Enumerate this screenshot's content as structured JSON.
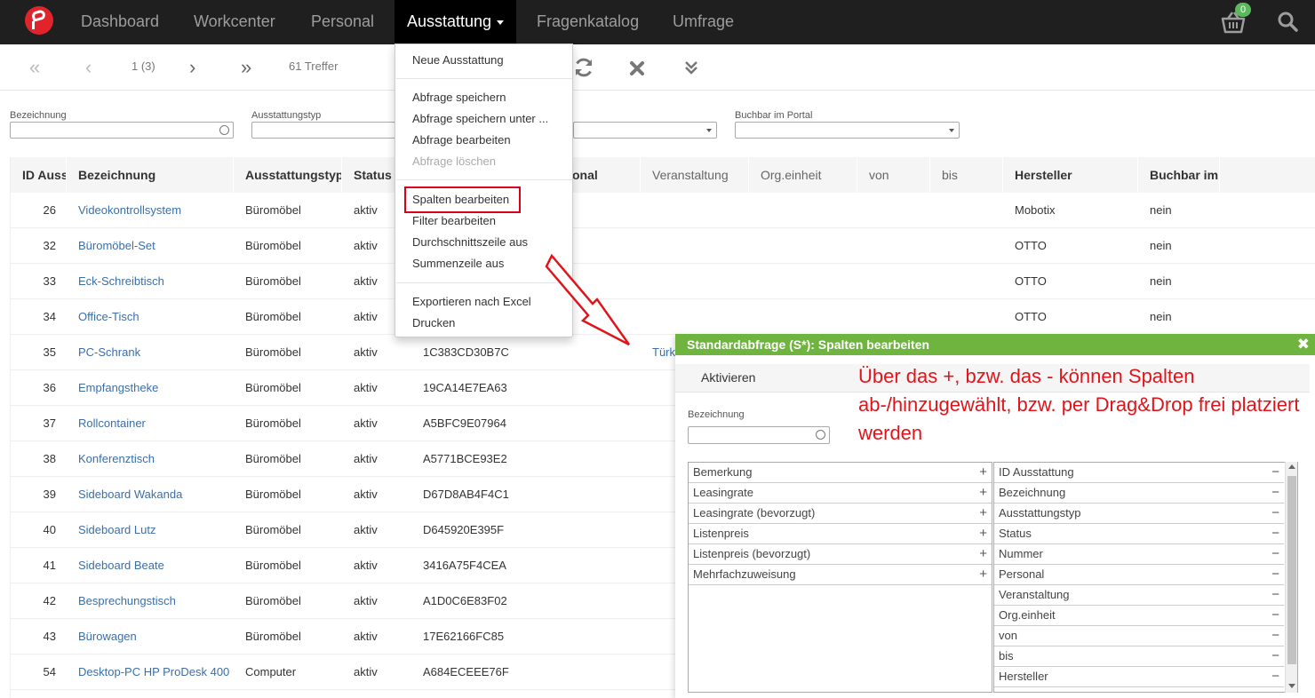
{
  "nav": {
    "items": [
      {
        "label": "Dashboard"
      },
      {
        "label": "Workcenter"
      },
      {
        "label": "Personal"
      },
      {
        "label": "Ausstattung"
      },
      {
        "label": "Fragenkatalog"
      },
      {
        "label": "Umfrage"
      }
    ],
    "active_index": 3,
    "cart_count": "0"
  },
  "toolbar": {
    "page": "1 (3)",
    "hits": "61 Treffer"
  },
  "filters": [
    {
      "label": "Bezeichnung",
      "value": ""
    },
    {
      "label": "Ausstattungstyp",
      "value": ""
    },
    {
      "label": "Buchbar im Portal",
      "value": ""
    }
  ],
  "grid": {
    "columns": [
      "ID Ausst",
      "Bezeichnung",
      "Ausstattungstyp",
      "Status",
      "",
      "onal",
      "Veranstaltung",
      "Org.einheit",
      "von",
      "bis",
      "Hersteller",
      "Buchbar im I"
    ],
    "rows": [
      {
        "id": "26",
        "name": "Videokontrollsystem",
        "type": "Büromöbel",
        "status": "aktiv",
        "number": "",
        "veranstaltung": "",
        "maker": "Mobotix",
        "book": "nein"
      },
      {
        "id": "32",
        "name": "Büromöbel-Set",
        "type": "Büromöbel",
        "status": "aktiv",
        "number": "",
        "veranstaltung": "",
        "maker": "OTTO",
        "book": "nein"
      },
      {
        "id": "33",
        "name": "Eck-Schreibtisch",
        "type": "Büromöbel",
        "status": "aktiv",
        "number": "",
        "veranstaltung": "",
        "maker": "OTTO",
        "book": "nein"
      },
      {
        "id": "34",
        "name": "Office-Tisch",
        "type": "Büromöbel",
        "status": "aktiv",
        "number": "",
        "veranstaltung": "",
        "maker": "OTTO",
        "book": "nein"
      },
      {
        "id": "35",
        "name": "PC-Schrank",
        "type": "Büromöbel",
        "status": "aktiv",
        "number": "1C383CD30B7C",
        "veranstaltung": "Türk",
        "maker": "",
        "book": ""
      },
      {
        "id": "36",
        "name": "Empfangstheke",
        "type": "Büromöbel",
        "status": "aktiv",
        "number": "19CA14E7EA63",
        "veranstaltung": "",
        "maker": "",
        "book": ""
      },
      {
        "id": "37",
        "name": "Rollcontainer",
        "type": "Büromöbel",
        "status": "aktiv",
        "number": "A5BFC9E07964",
        "veranstaltung": "",
        "maker": "",
        "book": ""
      },
      {
        "id": "38",
        "name": "Konferenztisch",
        "type": "Büromöbel",
        "status": "aktiv",
        "number": "A5771BCE93E2",
        "veranstaltung": "",
        "maker": "",
        "book": ""
      },
      {
        "id": "39",
        "name": "Sideboard Wakanda",
        "type": "Büromöbel",
        "status": "aktiv",
        "number": "D67D8AB4F4C1",
        "veranstaltung": "",
        "maker": "",
        "book": ""
      },
      {
        "id": "40",
        "name": "Sideboard Lutz",
        "type": "Büromöbel",
        "status": "aktiv",
        "number": "D645920E395F",
        "veranstaltung": "",
        "maker": "",
        "book": ""
      },
      {
        "id": "41",
        "name": "Sideboard Beate",
        "type": "Büromöbel",
        "status": "aktiv",
        "number": "3416A75F4CEA",
        "veranstaltung": "",
        "maker": "",
        "book": ""
      },
      {
        "id": "42",
        "name": "Besprechungstisch",
        "type": "Büromöbel",
        "status": "aktiv",
        "number": "A1D0C6E83F02",
        "veranstaltung": "",
        "maker": "",
        "book": ""
      },
      {
        "id": "43",
        "name": "Bürowagen",
        "type": "Büromöbel",
        "status": "aktiv",
        "number": "17E62166FC85",
        "veranstaltung": "",
        "maker": "",
        "book": ""
      },
      {
        "id": "54",
        "name": "Desktop-PC HP ProDesk 400",
        "type": "Computer",
        "status": "aktiv",
        "number": "A684ECEEE76F",
        "veranstaltung": "",
        "maker": "",
        "book": ""
      }
    ]
  },
  "menu": {
    "groups": [
      [
        {
          "label": "Neue Ausstattung",
          "disabled": false
        }
      ],
      [
        {
          "label": "Abfrage speichern",
          "disabled": false
        },
        {
          "label": "Abfrage speichern unter ...",
          "disabled": false
        },
        {
          "label": "Abfrage bearbeiten",
          "disabled": false
        },
        {
          "label": "Abfrage löschen",
          "disabled": true
        }
      ],
      [
        {
          "label": "Spalten bearbeiten",
          "disabled": false
        },
        {
          "label": "Filter bearbeiten",
          "disabled": false
        },
        {
          "label": "Durchschnittszeile aus",
          "disabled": false
        },
        {
          "label": "Summenzeile aus",
          "disabled": false
        }
      ],
      [
        {
          "label": "Exportieren nach Excel",
          "disabled": false
        },
        {
          "label": "Drucken",
          "disabled": false
        }
      ]
    ]
  },
  "dialog": {
    "title": "Standardabfrage (S*): Spalten bearbeiten",
    "activate": "Aktivieren",
    "note": "Über das +, bzw. das - können Spalten ab-/hinzugewählt, bzw. per Drag&Drop frei platziert werden",
    "filter_label": "Bezeichnung",
    "filter_value": "",
    "available": [
      "Bemerkung",
      "Leasingrate",
      "Leasingrate (bevorzugt)",
      "Listenpreis",
      "Listenpreis (bevorzugt)",
      "Mehrfachzuweisung"
    ],
    "selected": [
      "ID Ausstattung",
      "Bezeichnung",
      "Ausstattungstyp",
      "Status",
      "Nummer",
      "Personal",
      "Veranstaltung",
      "Org.einheit",
      "von",
      "bis",
      "Hersteller"
    ],
    "add_symbol": "+",
    "remove_symbol": "−"
  },
  "colors": {
    "nav_bg": "#1f1f1f",
    "dialog_header": "#6fb43f",
    "link": "#3c6ea8",
    "highlight": "#d9001b",
    "annotation": "#e0151b"
  }
}
